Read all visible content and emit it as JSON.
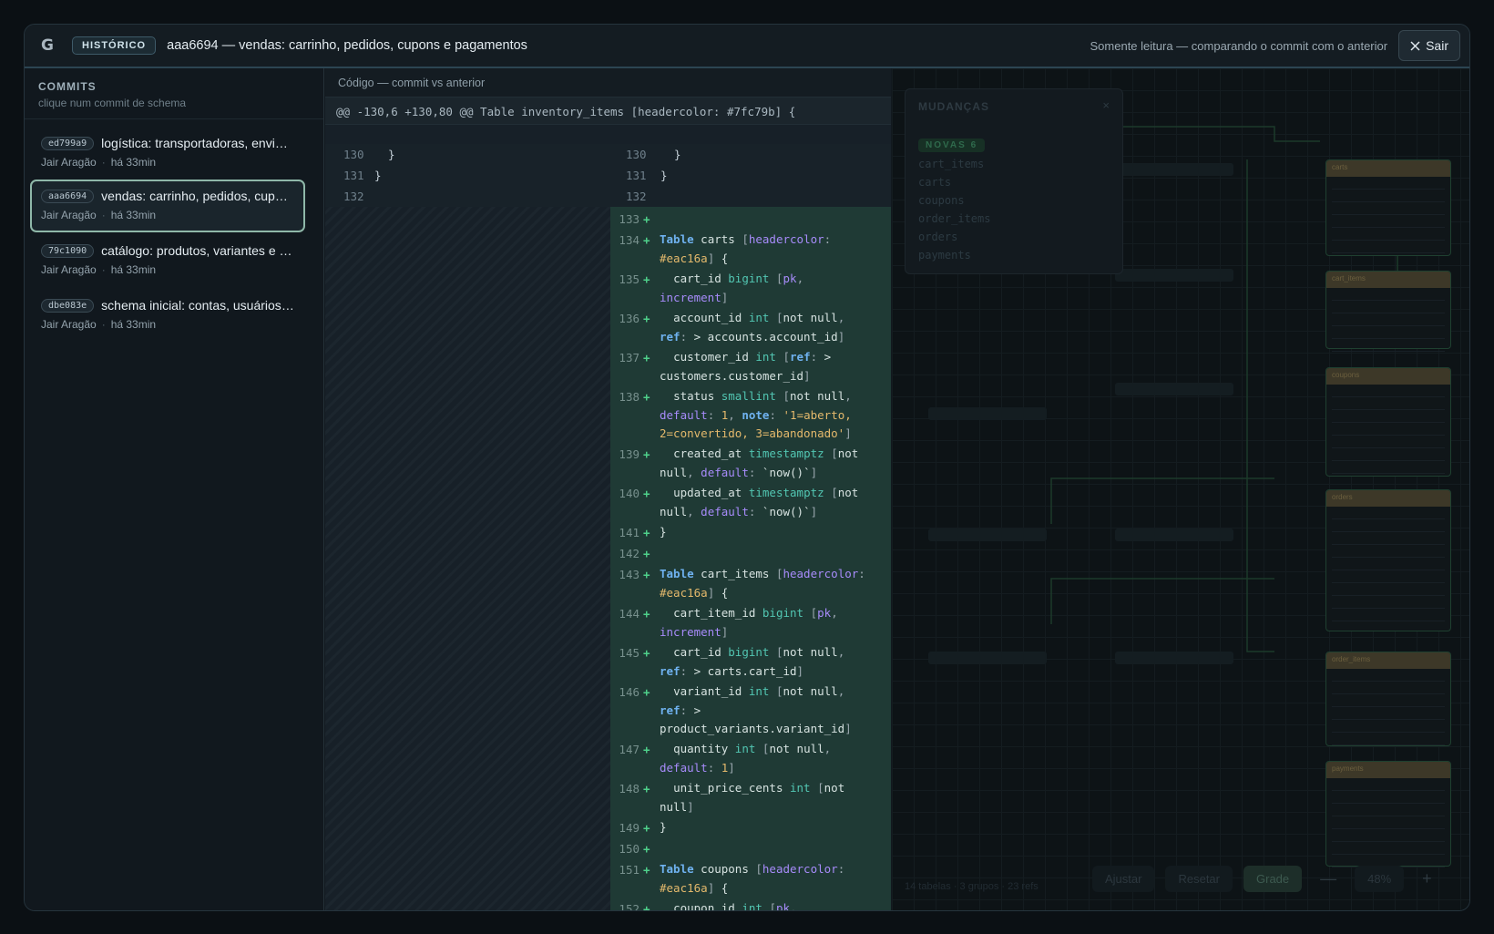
{
  "header": {
    "logo": "G",
    "badge": "HISTÓRICO",
    "title": "aaa6694 — vendas: carrinho, pedidos, cupons e pagamentos",
    "note": "Somente leitura — comparando o commit com o anterior",
    "exit_label": "Sair"
  },
  "sidebar": {
    "title": "COMMITS",
    "subtitle": "clique num commit de schema",
    "commits": [
      {
        "hash": "ed799a9",
        "message": "logística: transportadoras, envios, rastreamento",
        "author": "Jair Aragão",
        "time": "há 33min"
      },
      {
        "hash": "aaa6694",
        "message": "vendas: carrinho, pedidos, cupons e pagamentos",
        "author": "Jair Aragão",
        "time": "há 33min"
      },
      {
        "hash": "79c1090",
        "message": "catálogo: produtos, variantes e estoque",
        "author": "Jair Aragão",
        "time": "há 33min"
      },
      {
        "hash": "dbe083e",
        "message": "schema inicial: contas, usuários e clientes",
        "author": "Jair Aragão",
        "time": "há 33min"
      }
    ]
  },
  "code": {
    "title": "Código — commit vs anterior",
    "hunk": "@@ -130,6 +130,80 @@ Table inventory_items [headercolor: #7fc79b] {",
    "context": [
      {
        "old": "130",
        "new": "130",
        "text": "  }"
      },
      {
        "old": "131",
        "new": "131",
        "text": "}"
      },
      {
        "old": "132",
        "new": "132",
        "text": ""
      }
    ],
    "added_numbers": [
      "133",
      "134",
      "135",
      "136",
      "137",
      "138",
      "139",
      "140",
      "141",
      "142",
      "143",
      "144",
      "145",
      "146",
      "147",
      "148",
      "149",
      "150",
      "151",
      "152"
    ]
  },
  "changes": {
    "title": "MUDANÇAS",
    "badge": "NOVAS 6",
    "items": [
      "cart_items",
      "carts",
      "coupons",
      "order_items",
      "orders",
      "payments"
    ]
  },
  "canvas": {
    "tables": [
      "carts",
      "cart_items",
      "coupons",
      "orders",
      "order_items",
      "payments"
    ],
    "status": "14 tabelas · 3 grupos · 23 refs",
    "toolbar": {
      "fit": "Ajustar",
      "reset": "Resetar",
      "grid": "Grade",
      "minus": "—",
      "zoom": "48%",
      "plus": "+"
    }
  },
  "colors": {
    "accent": "#8fb8a9",
    "added_bg": "#1f3a35",
    "plus": "#4fd18b",
    "header": "#eac16a"
  }
}
